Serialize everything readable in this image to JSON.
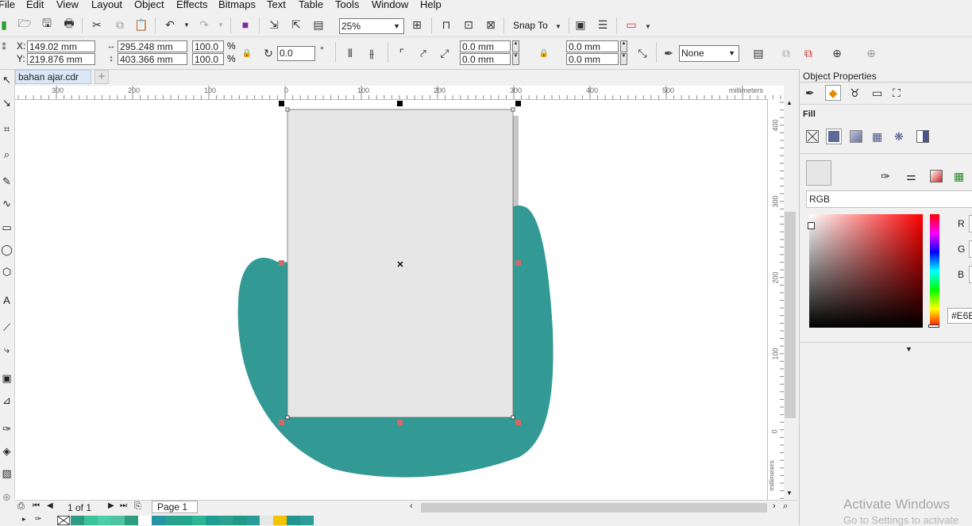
{
  "menu": [
    "File",
    "Edit",
    "View",
    "Layout",
    "Object",
    "Effects",
    "Bitmaps",
    "Text",
    "Table",
    "Tools",
    "Window",
    "Help"
  ],
  "toolbar": {
    "zoom_value": "25%",
    "snap_to_label": "Snap To"
  },
  "properties": {
    "x_label": "X:",
    "x_value": "149.02 mm",
    "y_label": "Y:",
    "y_value": "219.876 mm",
    "width_value": "295.248 mm",
    "height_value": "403.366 mm",
    "scale_w": "100.0",
    "scale_h": "100.0",
    "percent": "%",
    "rotation": "0.0",
    "degree": "°",
    "corner_tl": "0.0 mm",
    "corner_bl": "0.0 mm",
    "corner_tr": "0.0 mm",
    "corner_br": "0.0 mm",
    "outline": "None"
  },
  "document": {
    "tab_name": "bahan ajar.cdr",
    "add_tab": "+"
  },
  "ruler_h": {
    "labels": [
      "300",
      "200",
      "100",
      "0",
      "100",
      "200",
      "300",
      "400",
      "500"
    ],
    "unit": "millimeters"
  },
  "ruler_v": {
    "labels": [
      "400",
      "300",
      "200",
      "100",
      "0"
    ],
    "unit": "millimeters"
  },
  "pagenav": {
    "page_count": "1 of 1",
    "page_tab": "Page 1"
  },
  "colors": {
    "teal_shape": "#339994",
    "rectangle_fill": "#e6e6e6",
    "page_shadow": "#c6c6c6"
  },
  "palette": [
    "#2e9b82",
    "#3cc39a",
    "#48cfa5",
    "#4fc4a0",
    "#2f9d82",
    "#ffffff",
    "#2594a4",
    "#27a28f",
    "#22a68b",
    "#2cb694",
    "#1e9e91",
    "#2ea08f",
    "#229985",
    "#2a9b98",
    "#e6e6e6",
    "#f5c400",
    "#22958f",
    "#2d9b96"
  ],
  "docker": {
    "title": "Object Properties",
    "fill_heading": "Fill",
    "color_model": "RGB",
    "r_label": "R",
    "g_label": "G",
    "b_label": "B",
    "hex_value": "#E6E"
  },
  "watermark": {
    "line1": "Activate Windows",
    "line2": "Go to Settings to activate"
  }
}
